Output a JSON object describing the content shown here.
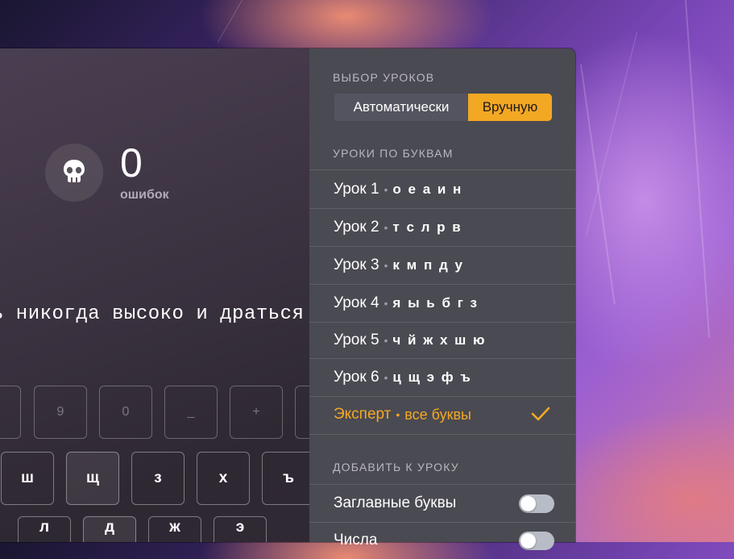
{
  "stats": {
    "errors_value": "0",
    "errors_label": "ошибок",
    "icon": "skull-icon"
  },
  "typing_text": "ь никогда высоко и драться",
  "keyboard": {
    "row1": [
      "9",
      "0",
      "_",
      "+"
    ],
    "row2": [
      "ш",
      "щ",
      "з",
      "х",
      "ъ"
    ],
    "row3": [
      "л",
      "д",
      "ж",
      "э"
    ]
  },
  "menu": {
    "lesson_choice_header": "ВЫБОР УРОКОВ",
    "mode_auto": "Автоматически",
    "mode_manual": "Вручную",
    "selected_mode": "Вручную",
    "letters_header": "УРОКИ ПО БУКВАМ",
    "lessons": [
      {
        "name": "Урок 1",
        "sep": "•",
        "letters": "о е а и н"
      },
      {
        "name": "Урок 2",
        "sep": "•",
        "letters": "т с л р в"
      },
      {
        "name": "Урок 3",
        "sep": "•",
        "letters": "к м п д у"
      },
      {
        "name": "Урок 4",
        "sep": "•",
        "letters": "я ы ь б г з"
      },
      {
        "name": "Урок 5",
        "sep": "•",
        "letters": "ч й ж х ш ю"
      },
      {
        "name": "Урок 6",
        "sep": "•",
        "letters": "ц щ э ф ъ"
      }
    ],
    "expert": {
      "name": "Эксперт",
      "sep": "•",
      "letters": "все буквы",
      "selected": true
    },
    "add_header": "ДОБАВИТЬ К УРОКУ",
    "toggles": [
      {
        "label": "Заглавные буквы",
        "on": false
      },
      {
        "label": "Числа",
        "on": false
      }
    ]
  },
  "colors": {
    "accent": "#f3a824",
    "menu_bg": "#4a4a52"
  }
}
